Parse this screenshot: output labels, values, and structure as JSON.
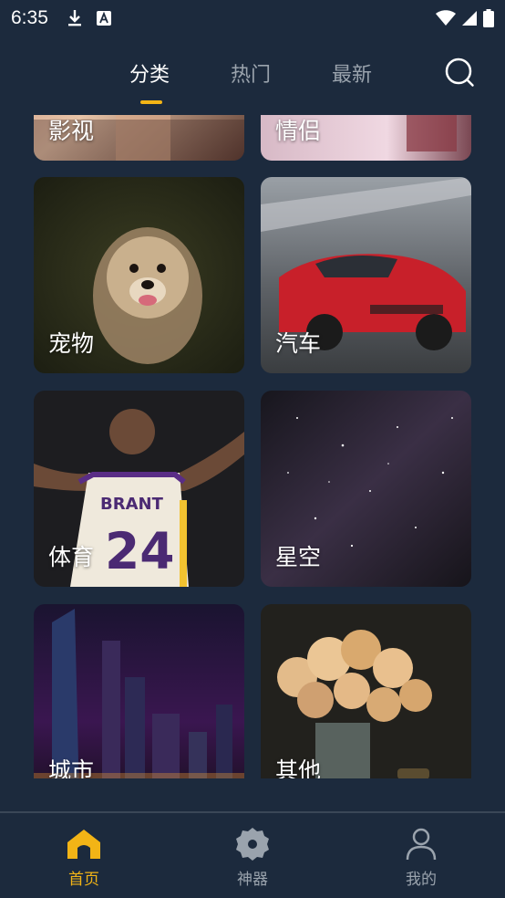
{
  "status_bar": {
    "time": "6:35",
    "left_icons": [
      "download-icon",
      "font-a-icon"
    ],
    "right_icons": [
      "wifi-icon",
      "signal-icon",
      "battery-icon"
    ]
  },
  "top_nav": {
    "tabs": [
      {
        "label": "分类",
        "active": true
      },
      {
        "label": "热门",
        "active": false
      },
      {
        "label": "最新",
        "active": false
      }
    ],
    "search_icon": "search-icon",
    "accent_color": "#f2b416"
  },
  "categories": [
    {
      "label": "影视",
      "image": "movie-scene-photo"
    },
    {
      "label": "情侣",
      "image": "couple-photo"
    },
    {
      "label": "宠物",
      "image": "dog-photo"
    },
    {
      "label": "汽车",
      "image": "red-sports-car-photo"
    },
    {
      "label": "体育",
      "image": "basketball-player-photo"
    },
    {
      "label": "星空",
      "image": "starry-sky-photo"
    },
    {
      "label": "城市",
      "image": "city-night-photo"
    },
    {
      "label": "其他",
      "image": "flowers-vase-photo"
    }
  ],
  "bottom_nav": {
    "items": [
      {
        "label": "首页",
        "icon": "home-icon",
        "active": true
      },
      {
        "label": "神器",
        "icon": "gear-icon",
        "active": false
      },
      {
        "label": "我的",
        "icon": "user-icon",
        "active": false
      }
    ]
  },
  "colors": {
    "background": "#1c2a3d",
    "active": "#f2b416",
    "inactive": "#9aa3ad"
  }
}
